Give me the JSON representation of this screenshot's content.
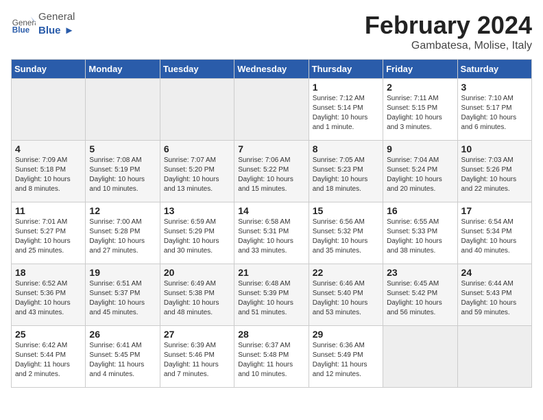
{
  "header": {
    "logo_general": "General",
    "logo_blue": "Blue",
    "title": "February 2024",
    "location": "Gambatesa, Molise, Italy"
  },
  "weekdays": [
    "Sunday",
    "Monday",
    "Tuesday",
    "Wednesday",
    "Thursday",
    "Friday",
    "Saturday"
  ],
  "weeks": [
    [
      {
        "day": "",
        "info": ""
      },
      {
        "day": "",
        "info": ""
      },
      {
        "day": "",
        "info": ""
      },
      {
        "day": "",
        "info": ""
      },
      {
        "day": "1",
        "info": "Sunrise: 7:12 AM\nSunset: 5:14 PM\nDaylight: 10 hours\nand 1 minute."
      },
      {
        "day": "2",
        "info": "Sunrise: 7:11 AM\nSunset: 5:15 PM\nDaylight: 10 hours\nand 3 minutes."
      },
      {
        "day": "3",
        "info": "Sunrise: 7:10 AM\nSunset: 5:17 PM\nDaylight: 10 hours\nand 6 minutes."
      }
    ],
    [
      {
        "day": "4",
        "info": "Sunrise: 7:09 AM\nSunset: 5:18 PM\nDaylight: 10 hours\nand 8 minutes."
      },
      {
        "day": "5",
        "info": "Sunrise: 7:08 AM\nSunset: 5:19 PM\nDaylight: 10 hours\nand 10 minutes."
      },
      {
        "day": "6",
        "info": "Sunrise: 7:07 AM\nSunset: 5:20 PM\nDaylight: 10 hours\nand 13 minutes."
      },
      {
        "day": "7",
        "info": "Sunrise: 7:06 AM\nSunset: 5:22 PM\nDaylight: 10 hours\nand 15 minutes."
      },
      {
        "day": "8",
        "info": "Sunrise: 7:05 AM\nSunset: 5:23 PM\nDaylight: 10 hours\nand 18 minutes."
      },
      {
        "day": "9",
        "info": "Sunrise: 7:04 AM\nSunset: 5:24 PM\nDaylight: 10 hours\nand 20 minutes."
      },
      {
        "day": "10",
        "info": "Sunrise: 7:03 AM\nSunset: 5:26 PM\nDaylight: 10 hours\nand 22 minutes."
      }
    ],
    [
      {
        "day": "11",
        "info": "Sunrise: 7:01 AM\nSunset: 5:27 PM\nDaylight: 10 hours\nand 25 minutes."
      },
      {
        "day": "12",
        "info": "Sunrise: 7:00 AM\nSunset: 5:28 PM\nDaylight: 10 hours\nand 27 minutes."
      },
      {
        "day": "13",
        "info": "Sunrise: 6:59 AM\nSunset: 5:29 PM\nDaylight: 10 hours\nand 30 minutes."
      },
      {
        "day": "14",
        "info": "Sunrise: 6:58 AM\nSunset: 5:31 PM\nDaylight: 10 hours\nand 33 minutes."
      },
      {
        "day": "15",
        "info": "Sunrise: 6:56 AM\nSunset: 5:32 PM\nDaylight: 10 hours\nand 35 minutes."
      },
      {
        "day": "16",
        "info": "Sunrise: 6:55 AM\nSunset: 5:33 PM\nDaylight: 10 hours\nand 38 minutes."
      },
      {
        "day": "17",
        "info": "Sunrise: 6:54 AM\nSunset: 5:34 PM\nDaylight: 10 hours\nand 40 minutes."
      }
    ],
    [
      {
        "day": "18",
        "info": "Sunrise: 6:52 AM\nSunset: 5:36 PM\nDaylight: 10 hours\nand 43 minutes."
      },
      {
        "day": "19",
        "info": "Sunrise: 6:51 AM\nSunset: 5:37 PM\nDaylight: 10 hours\nand 45 minutes."
      },
      {
        "day": "20",
        "info": "Sunrise: 6:49 AM\nSunset: 5:38 PM\nDaylight: 10 hours\nand 48 minutes."
      },
      {
        "day": "21",
        "info": "Sunrise: 6:48 AM\nSunset: 5:39 PM\nDaylight: 10 hours\nand 51 minutes."
      },
      {
        "day": "22",
        "info": "Sunrise: 6:46 AM\nSunset: 5:40 PM\nDaylight: 10 hours\nand 53 minutes."
      },
      {
        "day": "23",
        "info": "Sunrise: 6:45 AM\nSunset: 5:42 PM\nDaylight: 10 hours\nand 56 minutes."
      },
      {
        "day": "24",
        "info": "Sunrise: 6:44 AM\nSunset: 5:43 PM\nDaylight: 10 hours\nand 59 minutes."
      }
    ],
    [
      {
        "day": "25",
        "info": "Sunrise: 6:42 AM\nSunset: 5:44 PM\nDaylight: 11 hours\nand 2 minutes."
      },
      {
        "day": "26",
        "info": "Sunrise: 6:41 AM\nSunset: 5:45 PM\nDaylight: 11 hours\nand 4 minutes."
      },
      {
        "day": "27",
        "info": "Sunrise: 6:39 AM\nSunset: 5:46 PM\nDaylight: 11 hours\nand 7 minutes."
      },
      {
        "day": "28",
        "info": "Sunrise: 6:37 AM\nSunset: 5:48 PM\nDaylight: 11 hours\nand 10 minutes."
      },
      {
        "day": "29",
        "info": "Sunrise: 6:36 AM\nSunset: 5:49 PM\nDaylight: 11 hours\nand 12 minutes."
      },
      {
        "day": "",
        "info": ""
      },
      {
        "day": "",
        "info": ""
      }
    ]
  ]
}
